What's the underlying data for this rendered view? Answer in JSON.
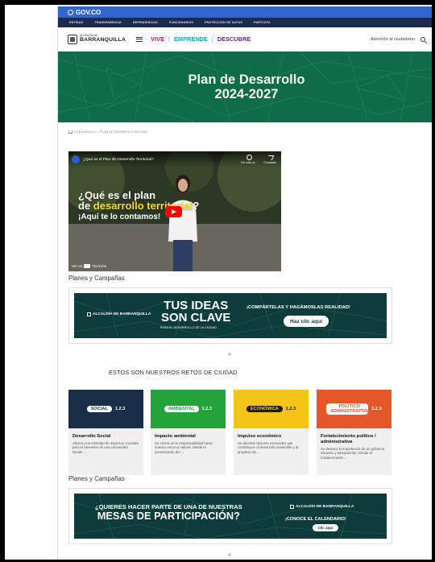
{
  "govbar": {
    "logo_text": "GOV.CO"
  },
  "transbar": {
    "items": [
      "ENTIDAD",
      "TRANSPARENCIA",
      "DEPENDENCIAS",
      "FUNCIONARIOS",
      "PROTECCIÓN DE DATOS",
      "PARTICIPA"
    ]
  },
  "header": {
    "brand_small": "ALCALDÍA DE",
    "brand_big": "BARRANQUILLA",
    "nav": {
      "vive": "VIVE",
      "emprende": "EMPRENDE",
      "descubre": "DESCUBRE",
      "sep": "|"
    },
    "atencion": "Atención al ciudadano",
    "colors": {
      "vive": "#c2185b",
      "emprende": "#1ea3c7",
      "descubre": "#5b2c8a"
    }
  },
  "banner": {
    "title_line1": "Plan de Desarrollo",
    "title_line2": "2024-2027",
    "bg": "#0f6b48"
  },
  "breadcrumb": {
    "items": [
      "> DESARROLLO",
      "> PLAN DE DESARROLLO 2024-2027"
    ]
  },
  "video": {
    "title": "¿Qué es el Plan de Desarrollo Territorial?",
    "watch_later": "Ver más ta...",
    "share": "Compartir",
    "headline_line1": "¿Qué es el plan",
    "headline_de": "de ",
    "headline_highlight": "desarrollo territorial",
    "headline_q": "?",
    "sub": "¡Aquí te lo contamos!",
    "yt_text": "Ver en",
    "yt_brand": "YouTube"
  },
  "campaigns_label": "Planes y Campañas",
  "campaign1": {
    "logo": "ALCALDÍA DE BARRANQUILLA",
    "big_line1": "TUS IDEAS",
    "big_line2": "SON CLAVE",
    "small": "PARA EL DESARROLLO DE LA CIUDAD",
    "right": "¡COMPÁRTELAS Y HAGÁMOSLAS REALIDAD!",
    "button": "Haz clic aquí"
  },
  "retos_title": "ESTOS SON NUESTROS RETOS DE CIUDAD",
  "retos": [
    {
      "pill": "SOCIAL",
      "num": "1.2.3",
      "name": "Desarrollo Social",
      "desc": "Abarca una variedad de aspectos cruciales para el bienestar de una comunidad. Desde ...",
      "bg": "#1a2e48",
      "pill_bg": "#ffffff",
      "pill_color": "#1a2e48",
      "num_color": "#ffffff"
    },
    {
      "pill": "AMBIENTAL",
      "num": "1.2.3",
      "name": "Impacto ambiental",
      "desc": "Se centra en la responsabilidad hacia nuestro entorno natural. Desde la preservación del ...",
      "bg": "#23a33a",
      "pill_bg": "#ffffff",
      "pill_color": "#23a33a",
      "num_color": "#ffffff"
    },
    {
      "pill": "ECONÓMICA",
      "num": "1.2.3",
      "name": "Impulso económico",
      "desc": "Se abordan factores esenciales que contribuyen al desarrollo sostenible y al progreso de ...",
      "bg": "#f4c416",
      "pill_bg": "#1a1a1a",
      "pill_color": "#f4c416",
      "num_color": "#1a1a1a"
    },
    {
      "pill": "POLÍTICO ADMINISTRATIVA",
      "num": "1.2.3",
      "name": "Fortalecimiento político / administrativa",
      "desc": "Se destaca la importancia de un gobierno eficiente y transparente. Desde el fortalecimiento ...",
      "bg": "#e4572a",
      "pill_bg": "#ffffff",
      "pill_color": "#e4572a",
      "num_color": "#ffffff"
    }
  ],
  "campaign2": {
    "big_line1": "¿QUIERES HACER PARTE DE UNA DE NUESTRAS",
    "big_line2": "MESAS DE PARTICIPACIÓN?",
    "logo": "ALCALDÍA DE BARRANQUILLA",
    "right": "¡CONOCE EL CALENDARIO!",
    "button": "Clic aquí"
  }
}
